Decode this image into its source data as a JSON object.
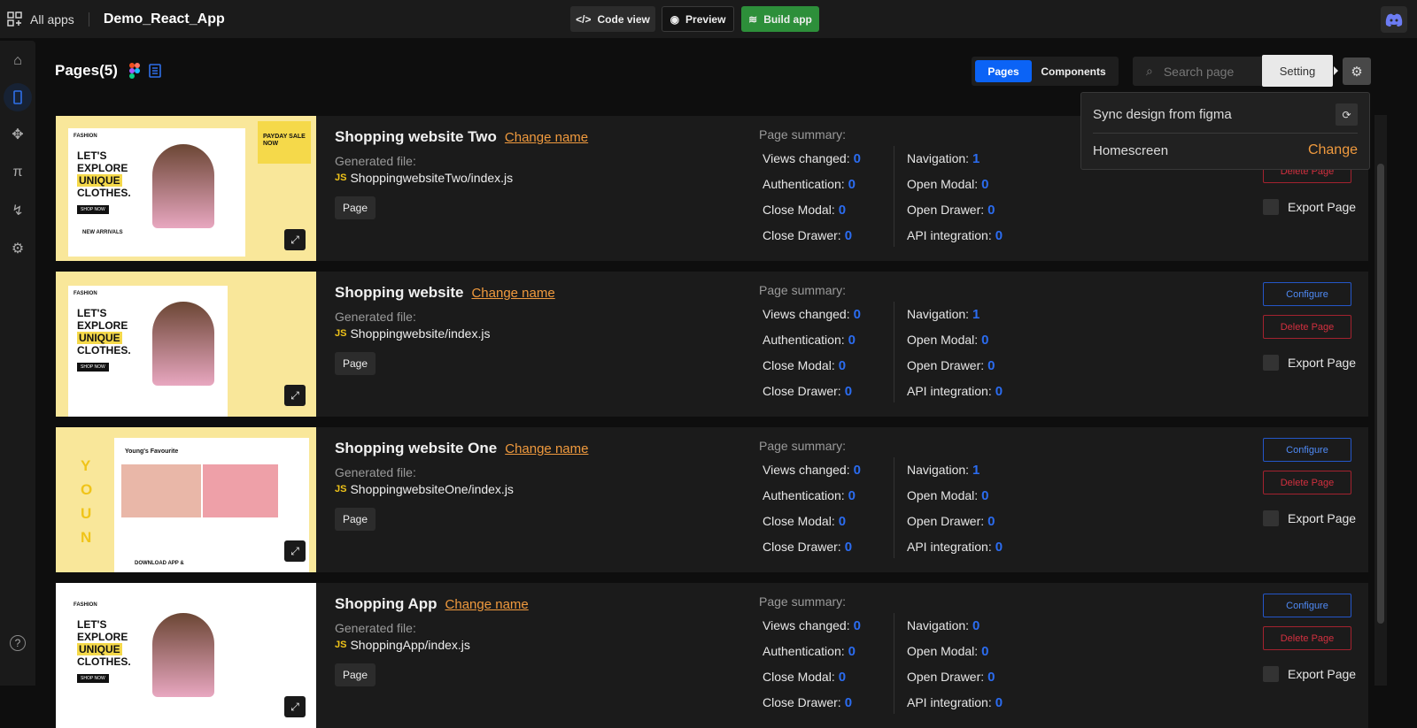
{
  "topbar": {
    "all_apps": "All apps",
    "app_title": "Demo_React_App",
    "code_view": "Code view",
    "preview": "Preview",
    "build_app": "Build app"
  },
  "header": {
    "title": "Pages(5)",
    "tabs": [
      "Pages",
      "Components"
    ],
    "search_placeholder": "Search page",
    "tooltip": "Setting"
  },
  "settings_popup": {
    "sync": "Sync design from figma",
    "homescreen": "Homescreen",
    "change": "Change"
  },
  "labels": {
    "change_name": "Change name",
    "generated_file": "Generated file:",
    "page_tag": "Page",
    "page_summary": "Page summary:",
    "configure": "Configure",
    "delete_page": "Delete Page",
    "export_page": "Export Page",
    "js": "JS"
  },
  "summary_keys": {
    "views": "Views changed:",
    "auth": "Authentication:",
    "close_modal": "Close Modal:",
    "close_drawer": "Close Drawer:",
    "nav": "Navigation:",
    "open_modal": "Open Modal:",
    "open_drawer": "Open Drawer:",
    "api": "API integration:"
  },
  "pages": [
    {
      "name": "Shopping website Two",
      "file": "ShoppingwebsiteTwo/index.js",
      "views": "0",
      "auth": "0",
      "close_modal": "0",
      "close_drawer": "0",
      "nav": "1",
      "open_modal": "0",
      "open_drawer": "0",
      "api": "0"
    },
    {
      "name": "Shopping website",
      "file": "Shoppingwebsite/index.js",
      "views": "0",
      "auth": "0",
      "close_modal": "0",
      "close_drawer": "0",
      "nav": "1",
      "open_modal": "0",
      "open_drawer": "0",
      "api": "0"
    },
    {
      "name": "Shopping website One",
      "file": "ShoppingwebsiteOne/index.js",
      "views": "0",
      "auth": "0",
      "close_modal": "0",
      "close_drawer": "0",
      "nav": "1",
      "open_modal": "0",
      "open_drawer": "0",
      "api": "0"
    },
    {
      "name": "Shopping App",
      "file": "ShoppingApp/index.js",
      "views": "0",
      "auth": "0",
      "close_modal": "0",
      "close_drawer": "0",
      "nav": "0",
      "open_modal": "0",
      "open_drawer": "0",
      "api": "0"
    }
  ],
  "thumbs": {
    "brand": "FASHION",
    "line1": "LET'S",
    "line2": "EXPLORE",
    "line3": "UNIQUE",
    "line4": "CLOTHES.",
    "shop": "SHOP NOW",
    "payday": "PAYDAY SALE NOW",
    "new_arrivals": "NEW ARRIVALS",
    "favourite": "Young's Favourite",
    "young": "YOUN",
    "download": "DOWNLOAD APP &"
  },
  "colors": {
    "accent": "#0b63f6",
    "build": "#2d8f3a",
    "link": "#f09a3e",
    "danger": "#c8283a"
  }
}
